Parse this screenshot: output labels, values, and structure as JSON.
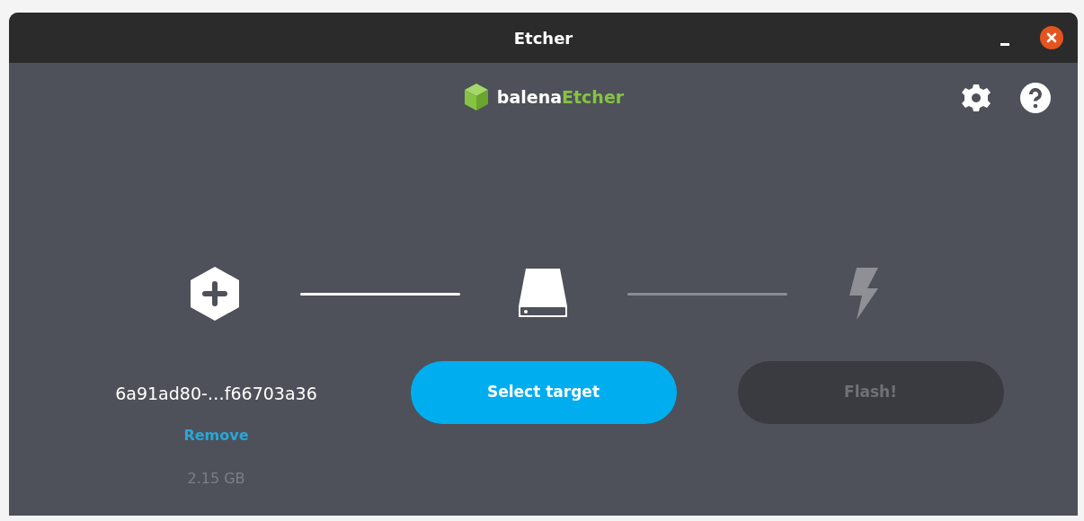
{
  "window": {
    "title": "Etcher"
  },
  "logo": {
    "prefix": "balena",
    "suffix": "Etcher"
  },
  "connectors": [
    {
      "active": true
    },
    {
      "active": false
    }
  ],
  "source": {
    "name": "6a91ad80-…f66703a36",
    "remove": "Remove",
    "size": "2.15 GB"
  },
  "target": {
    "button": "Select target",
    "disabled": false
  },
  "flash": {
    "button": "Flash!",
    "disabled": true
  }
}
